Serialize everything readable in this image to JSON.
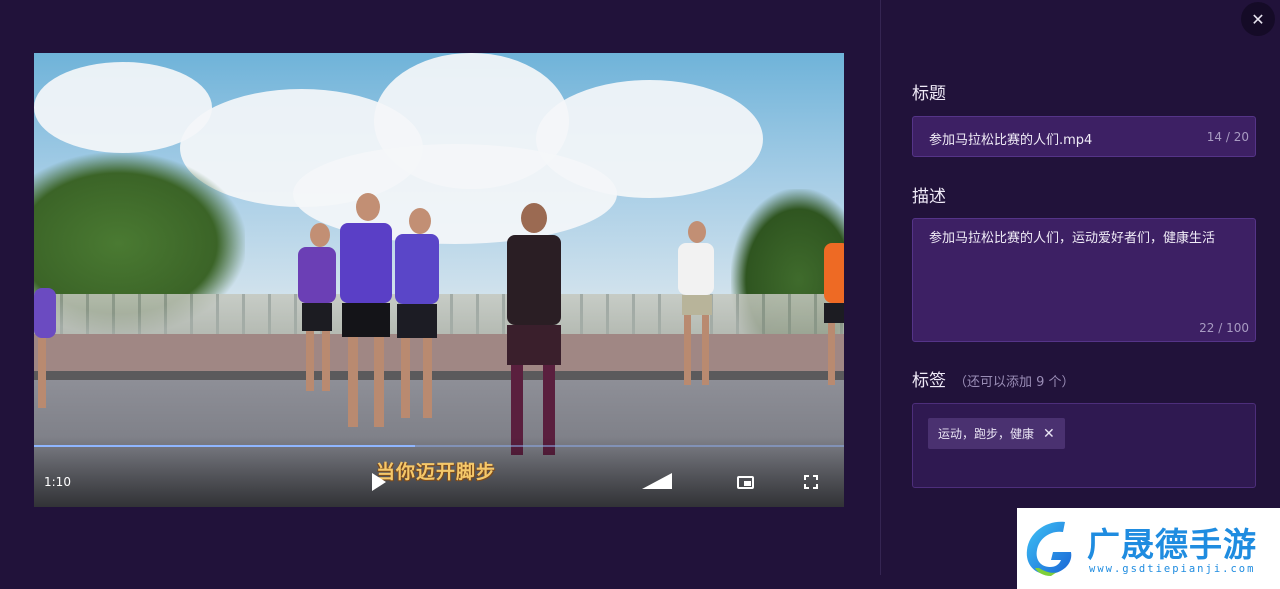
{
  "dialog": {
    "close_icon": "close-icon"
  },
  "video": {
    "time_display": "1:10",
    "subtitle": "当你迈开脚步",
    "progress": 0.47,
    "controls": {
      "play_icon": "play-icon",
      "volume_icon": "volume-icon",
      "pip_icon": "picture-in-picture-icon",
      "fullscreen_icon": "fullscreen-icon"
    }
  },
  "form": {
    "title": {
      "label": "标题",
      "value": "参加马拉松比赛的人们.mp4",
      "count": "14 / 20"
    },
    "description": {
      "label": "描述",
      "value": "参加马拉松比赛的人们，运动爱好者们，健康生活",
      "count": "22 / 100"
    },
    "tags": {
      "label": "标签",
      "hint": "（还可以添加 9 个）",
      "items": [
        "运动，跑步，健康"
      ]
    }
  },
  "watermark": {
    "brand": "广晟德手游",
    "url": "www.gsdtiepianji.com"
  },
  "colors": {
    "background": "#21123a",
    "field_bg": "#3d2064",
    "accent": "#1f8ce0"
  }
}
